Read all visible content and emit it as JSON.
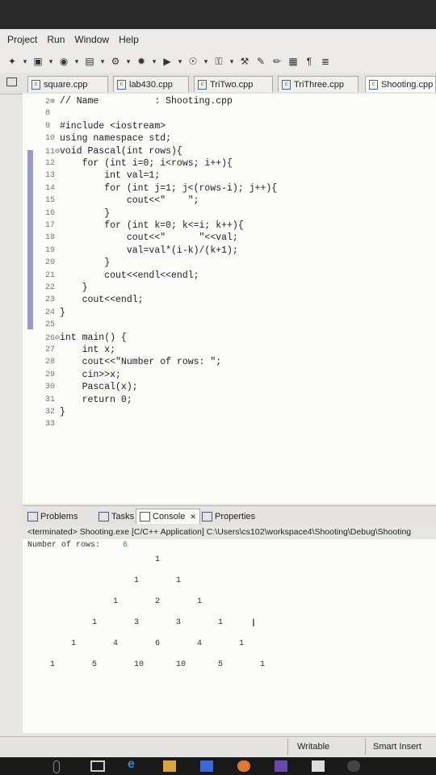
{
  "menu": [
    "Project",
    "Run",
    "Window",
    "Help"
  ],
  "toolbar_icons": [
    "bug-icon",
    "debug-icon",
    "run-icon",
    "new-icon",
    "settings-icon",
    "star-icon",
    "play-icon",
    "search-icon",
    "key-icon",
    "tools-icon",
    "brush-icon",
    "pencil-icon",
    "grid-icon",
    "paragraph-icon",
    "tree-icon"
  ],
  "tabs": [
    {
      "label": "square.cpp",
      "active": false
    },
    {
      "label": "lab430.cpp",
      "active": false
    },
    {
      "label": "TriTwo.cpp",
      "active": false
    },
    {
      "label": "TriThree.cpp",
      "active": false
    },
    {
      "label": "Shooting.cpp",
      "active": true
    }
  ],
  "editor": {
    "lines": [
      {
        "num": "2⊕",
        "code": "// Name          : Shooting.cpp"
      },
      {
        "num": "8",
        "code": ""
      },
      {
        "num": "9",
        "code": "#include <iostream>"
      },
      {
        "num": "10",
        "code": "using namespace std;"
      },
      {
        "num": "11⊖",
        "code": "void Pascal(int rows){"
      },
      {
        "num": "12",
        "code": "    for (int i=0; i<rows; i++){"
      },
      {
        "num": "13",
        "code": "        int val=1;"
      },
      {
        "num": "14",
        "code": "        for (int j=1; j<(rows-i); j++){"
      },
      {
        "num": "15",
        "code": "            cout<<\"    \";"
      },
      {
        "num": "16",
        "code": "        }"
      },
      {
        "num": "17",
        "code": "        for (int k=0; k<=i; k++){"
      },
      {
        "num": "18",
        "code": "            cout<<\"      \"<<val;"
      },
      {
        "num": "19",
        "code": "            val=val*(i-k)/(k+1);"
      },
      {
        "num": "20",
        "code": "        }"
      },
      {
        "num": "21",
        "code": "        cout<<endl<<endl;"
      },
      {
        "num": "22",
        "code": "    }"
      },
      {
        "num": "23",
        "code": "    cout<<endl;"
      },
      {
        "num": "24",
        "code": "}"
      },
      {
        "num": "25",
        "code": ""
      },
      {
        "num": "26⊖",
        "code": "int main() {"
      },
      {
        "num": "27",
        "code": "    int x;"
      },
      {
        "num": "28",
        "code": "    cout<<\"Number of rows: \";"
      },
      {
        "num": "29",
        "code": "    cin>>x;"
      },
      {
        "num": "30",
        "code": "    Pascal(x);"
      },
      {
        "num": "31",
        "code": "    return 0;"
      },
      {
        "num": "32",
        "code": "}"
      },
      {
        "num": "33",
        "code": ""
      }
    ]
  },
  "console_tabs": [
    {
      "label": "Problems",
      "active": false
    },
    {
      "label": "Tasks",
      "active": false
    },
    {
      "label": "Console",
      "active": true
    },
    {
      "label": "Properties",
      "active": false
    }
  ],
  "console_close": "✕",
  "console_status": "<terminated> Shooting.exe [C/C++ Application] C:\\Users\\cs102\\workspace4\\Shooting\\Debug\\Shooting",
  "console_prompt": "Number of rows: ",
  "console_input": "6",
  "pascal_rows": [
    [
      "1"
    ],
    [
      "1",
      "1"
    ],
    [
      "1",
      "2",
      "1"
    ],
    [
      "1",
      "3",
      "3",
      "1"
    ],
    [
      "1",
      "4",
      "6",
      "4",
      "1"
    ],
    [
      "1",
      "5",
      "10",
      "10",
      "5",
      "1"
    ]
  ],
  "status": {
    "writable": "Writable",
    "insert": "Smart Insert"
  }
}
